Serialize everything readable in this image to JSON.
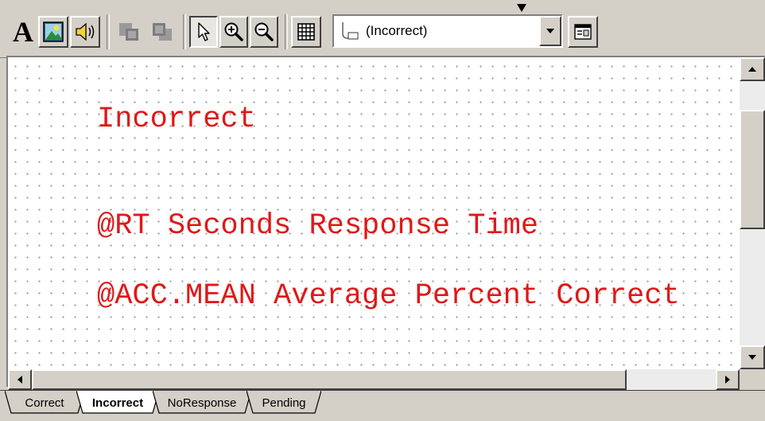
{
  "toolbar": {
    "state_combo": {
      "value": "(Incorrect)"
    },
    "icons": [
      "text-tool-icon",
      "image-tool-icon",
      "sound-tool-icon",
      "bring-forward-icon",
      "send-backward-icon",
      "select-pointer-icon",
      "zoom-in-icon",
      "zoom-out-icon",
      "grid-icon",
      "state-icon",
      "properties-icon"
    ]
  },
  "canvas": {
    "lines": [
      "Incorrect",
      "@RT Seconds Response Time",
      "@ACC.MEAN Average Percent Correct"
    ],
    "text_color": "#e01818"
  },
  "tabs": [
    {
      "label": "Correct",
      "active": false
    },
    {
      "label": "Incorrect",
      "active": true
    },
    {
      "label": "NoResponse",
      "active": false
    },
    {
      "label": "Pending",
      "active": false
    }
  ]
}
